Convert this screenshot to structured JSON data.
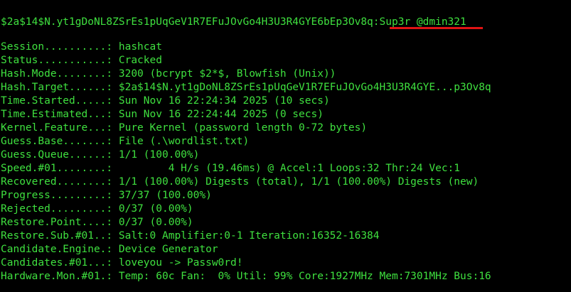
{
  "cracked": {
    "hash": "$2a$14$N.yt1gDoNL8ZSrEs1pUqGeV1R7EFuJOvGo4H3U3R4GYE6bEp3Ov8q",
    "separator": ":",
    "password": "Sup3r_@dmin321",
    "underline_color": "#e01414"
  },
  "status_rows": [
    {
      "key": "Session..........:",
      "value": " hashcat"
    },
    {
      "key": "Status...........:",
      "value": " Cracked"
    },
    {
      "key": "Hash.Mode........:",
      "value": " 3200 (bcrypt $2*$, Blowfish (Unix))"
    },
    {
      "key": "Hash.Target......:",
      "value": " $2a$14$N.yt1gDoNL8ZSrEs1pUqGeV1R7EFuJOvGo4H3U3R4GYE...p3Ov8q"
    },
    {
      "key": "Time.Started.....:",
      "value": " Sun Nov 16 22:24:34 2025 (10 secs)"
    },
    {
      "key": "Time.Estimated...:",
      "value": " Sun Nov 16 22:24:44 2025 (0 secs)"
    },
    {
      "key": "Kernel.Feature...:",
      "value": " Pure Kernel (password length 0-72 bytes)"
    },
    {
      "key": "Guess.Base.......:",
      "value": " File (.\\wordlist.txt)"
    },
    {
      "key": "Guess.Queue......:",
      "value": " 1/1 (100.00%)"
    },
    {
      "key": "Speed.#01........:",
      "value": "         4 H/s (19.46ms) @ Accel:1 Loops:32 Thr:24 Vec:1"
    },
    {
      "key": "Recovered........:",
      "value": " 1/1 (100.00%) Digests (total), 1/1 (100.00%) Digests (new)"
    },
    {
      "key": "Progress.........:",
      "value": " 37/37 (100.00%)"
    },
    {
      "key": "Rejected.........:",
      "value": " 0/37 (0.00%)"
    },
    {
      "key": "Restore.Point....:",
      "value": " 0/37 (0.00%)"
    },
    {
      "key": "Restore.Sub.#01..:",
      "value": " Salt:0 Amplifier:0-1 Iteration:16352-16384"
    },
    {
      "key": "Candidate.Engine.:",
      "value": " Device Generator"
    },
    {
      "key": "Candidates.#01...:",
      "value": " loveyou -> Passw0rd!"
    },
    {
      "key": "Hardware.Mon.#01.:",
      "value": " Temp: 60c Fan:  0% Util: 99% Core:1927MHz Mem:7301MHz Bus:16"
    }
  ],
  "colors": {
    "background": "#000000",
    "text": "#3fe03f"
  }
}
